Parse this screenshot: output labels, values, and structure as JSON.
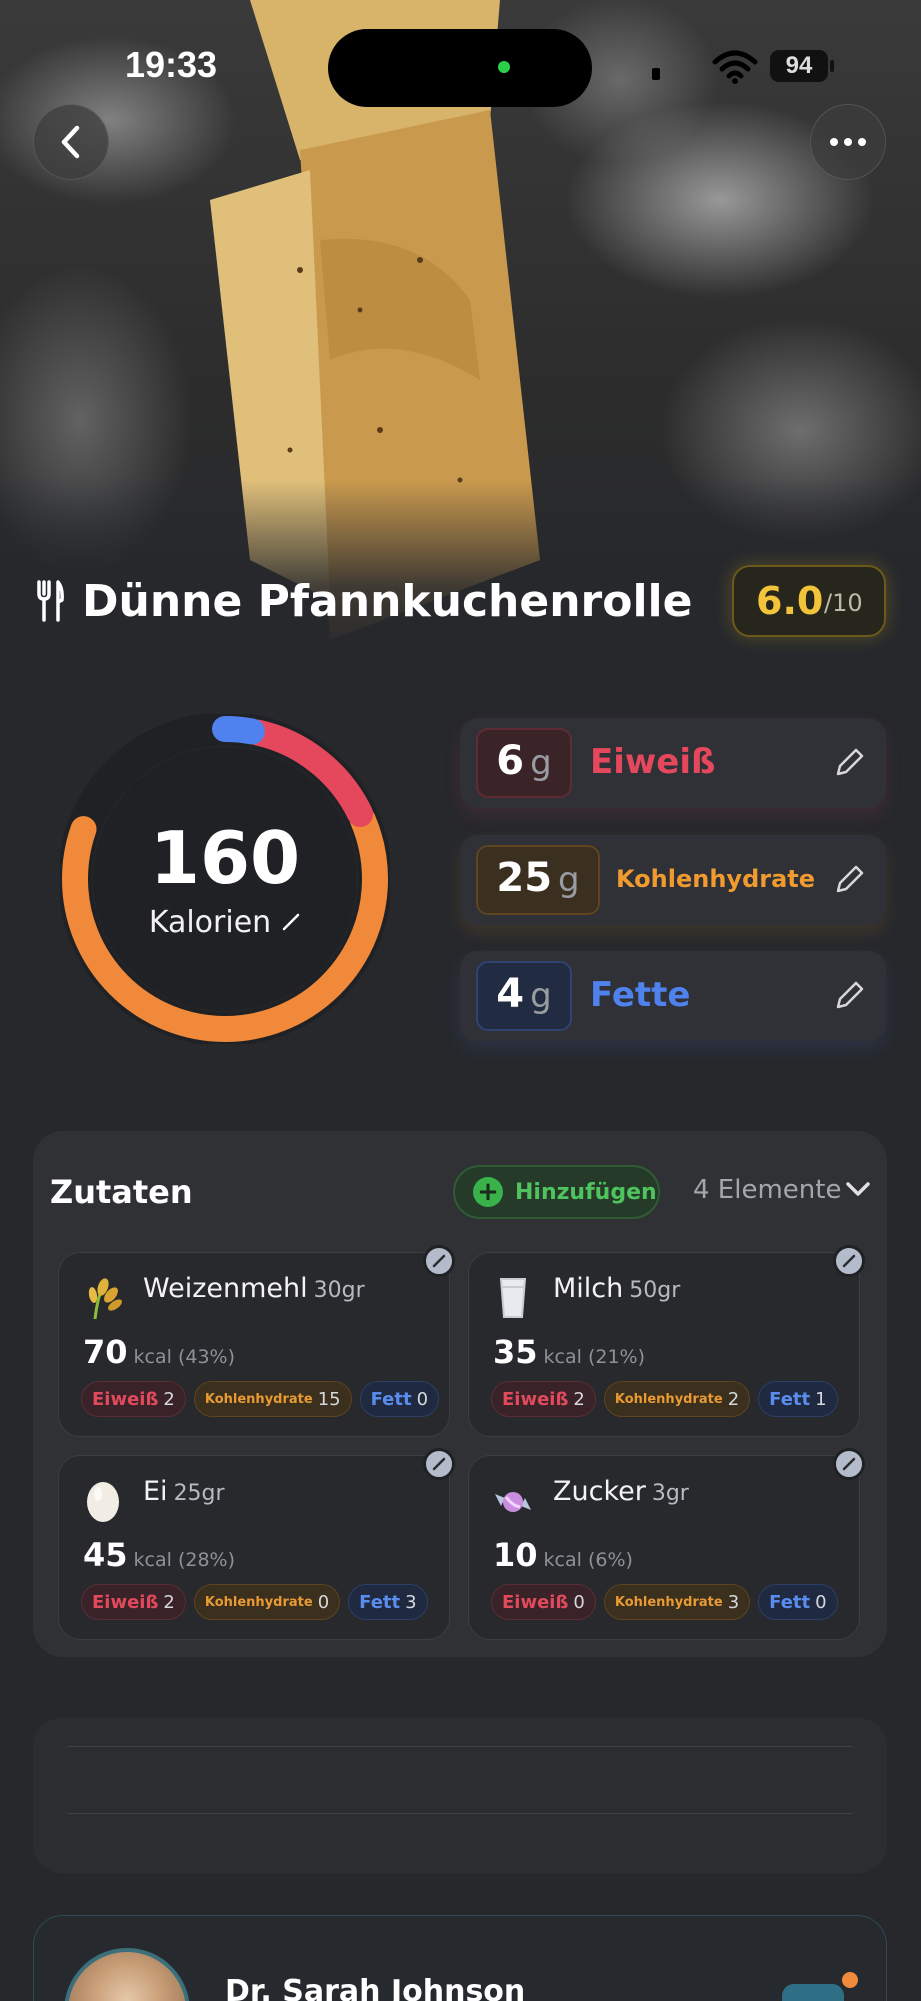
{
  "status_bar": {
    "time": "19:33",
    "battery": "94"
  },
  "meal": {
    "title": "Dünne Pfannkuchenrolle",
    "score": "6.0",
    "score_max": "/10"
  },
  "calories": {
    "value": "160",
    "label": "Kalorien"
  },
  "macros": [
    {
      "value": "6",
      "unit": "g",
      "name": "Eiweiß",
      "color": "#e5485d"
    },
    {
      "value": "25",
      "unit": "g",
      "name": "Kohlenhydrate",
      "color": "#f09a30"
    },
    {
      "value": "4",
      "unit": "g",
      "name": "Fette",
      "color": "#4f82ee"
    }
  ],
  "ring": {
    "protein": 6,
    "carbs": 25,
    "fat": 4,
    "colors": {
      "protein": "#e5485d",
      "carbs": "#f08a3a",
      "fat": "#4f82ee"
    }
  },
  "ingredients": {
    "title": "Zutaten",
    "add_label": "Hinzufügen",
    "count_label": "4 Elemente",
    "items": [
      {
        "name": "Weizenmehl",
        "grams": "30gr",
        "kcal": "70",
        "kcal_pct": "kcal (43%)",
        "icon": "wheat-icon",
        "protein_label": "Eiweiß",
        "protein": "2",
        "carbs_label": "Kohlenhydrate",
        "carbs": "15",
        "fat_label": "Fett",
        "fat": "0"
      },
      {
        "name": "Milch",
        "grams": "50gr",
        "kcal": "35",
        "kcal_pct": "kcal (21%)",
        "icon": "milk-glass-icon",
        "protein_label": "Eiweiß",
        "protein": "2",
        "carbs_label": "Kohlenhydrate",
        "carbs": "2",
        "fat_label": "Fett",
        "fat": "1"
      },
      {
        "name": "Ei",
        "grams": "25gr",
        "kcal": "45",
        "kcal_pct": "kcal (28%)",
        "icon": "egg-icon",
        "protein_label": "Eiweiß",
        "protein": "2",
        "carbs_label": "Kohlenhydrate",
        "carbs": "0",
        "fat_label": "Fett",
        "fat": "3"
      },
      {
        "name": "Zucker",
        "grams": "3gr",
        "kcal": "10",
        "kcal_pct": "kcal (6%)",
        "icon": "candy-icon",
        "protein_label": "Eiweiß",
        "protein": "0",
        "carbs_label": "Kohlenhydrate",
        "carbs": "3",
        "fat_label": "Fett",
        "fat": "0"
      }
    ]
  },
  "doctor": {
    "name": "Dr. Sarah Johnson"
  }
}
